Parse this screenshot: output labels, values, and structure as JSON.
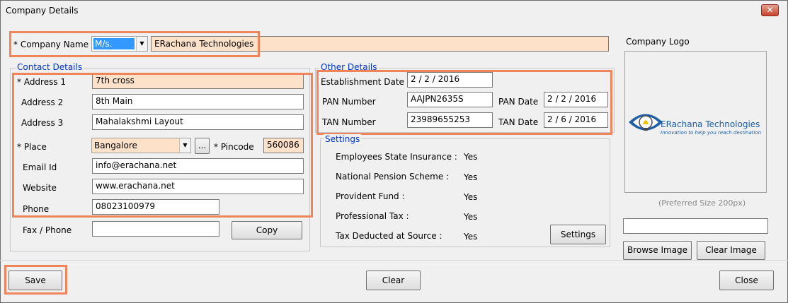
{
  "window": {
    "title": "Company Details",
    "close_glyph": "✕"
  },
  "company": {
    "label": "* Company Name",
    "prefix": "M/s.",
    "name": "ERachana Technologies"
  },
  "contact": {
    "group_label": "Contact Details",
    "address1_label": "* Address 1",
    "address1": "7th cross",
    "address2_label": "Address 2",
    "address2": "8th Main",
    "address3_label": "Address 3",
    "address3": "Mahalakshmi Layout",
    "place_label": "* Place",
    "place": "Bangalore",
    "place_browse": "...",
    "pincode_label": "* Pincode",
    "pincode": "560086",
    "email_label": "Email Id",
    "email": "info@erachana.net",
    "website_label": "Website",
    "website": "www.erachana.net",
    "phone_label": "Phone",
    "phone": "08023100979",
    "fax_label": "Fax / Phone",
    "fax": "",
    "copy_button": "Copy"
  },
  "other": {
    "group_label": "Other Details",
    "establishment_label": "Establishment Date",
    "establishment_date": "2 / 2 / 2016",
    "pan_label": "PAN Number",
    "pan_number": "AAJPN2635S",
    "pan_date_label": "PAN Date",
    "pan_date": "2 / 2 / 2016",
    "tan_label": "TAN Number",
    "tan_number": "23989655253",
    "tan_date_label": "TAN Date",
    "tan_date": "2 / 6 / 2016"
  },
  "settings": {
    "group_label": "Settings",
    "items": [
      {
        "label": "Employees State Insurance :",
        "value": "Yes"
      },
      {
        "label": "National Pension Scheme :",
        "value": "Yes"
      },
      {
        "label": "Provident Fund :",
        "value": "Yes"
      },
      {
        "label": "Professional Tax :",
        "value": "Yes"
      },
      {
        "label": "Tax Deducted at Source :",
        "value": "Yes"
      }
    ],
    "button": "Settings"
  },
  "logo": {
    "label": "Company Logo",
    "brand_name": "ERachana Technologies",
    "tagline": "Innovation to help you reach destination",
    "size_hint": "(Preferred Size 200px)",
    "path": "",
    "browse_button": "Browse Image",
    "clear_button": "Clear Image"
  },
  "footer": {
    "save": "Save",
    "clear": "Clear",
    "close": "Close"
  },
  "colors": {
    "highlight": "#f0845a",
    "peach_field": "#fde1c8",
    "group_label": "#0033cc",
    "prefix_selected": "#3399ff"
  }
}
